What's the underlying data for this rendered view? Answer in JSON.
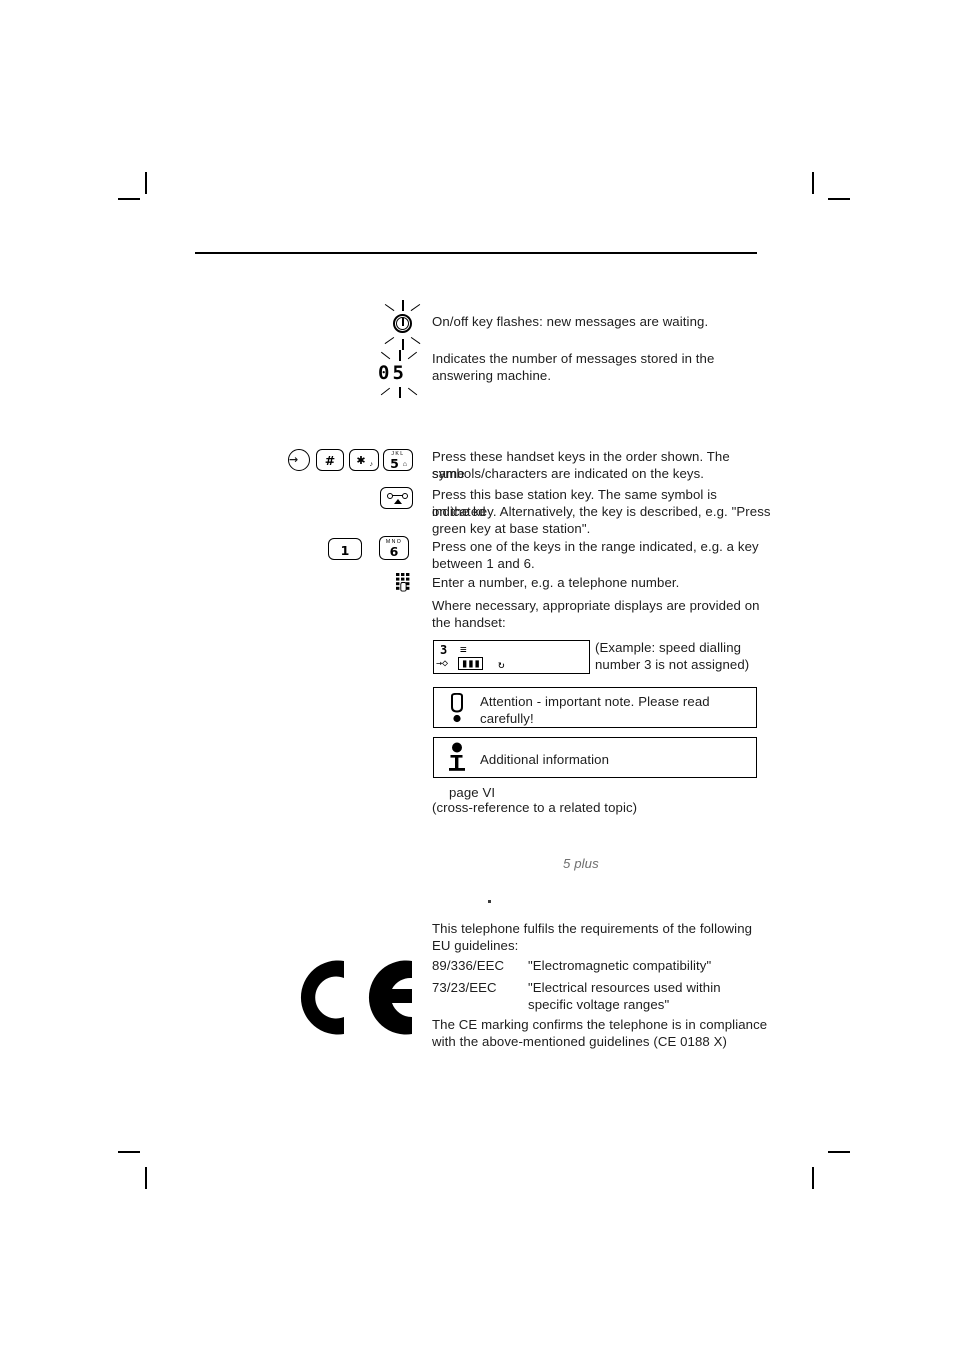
{
  "document": {
    "footer_note": "5 plus"
  },
  "legend": {
    "rows": [
      {
        "icon": "flashing-power-key-icon",
        "text": "On/off key flashes: new messages are waiting."
      },
      {
        "icon": "flashing-message-count-icon",
        "display_value": "05",
        "text_line1": "Indicates the number of messages stored in the",
        "text_line2": "answering machine."
      }
    ]
  },
  "keys_section": {
    "handset_keys": {
      "keys": [
        {
          "name": "arrow-in-circle-key",
          "main": "→",
          "sup": ""
        },
        {
          "name": "hash-key",
          "main": "#",
          "sup": ""
        },
        {
          "name": "star-key",
          "main": "✱",
          "sup": "",
          "sub": "♪"
        },
        {
          "name": "five-key",
          "main": "5",
          "sup": "JKL",
          "sub": "⌂"
        }
      ],
      "text_line1": "Press these handset keys in the order shown. The same",
      "text_line2": "symbols/characters are indicated on the keys."
    },
    "base_station_key": {
      "icon": "answering-machine-key-icon",
      "text_line1": "Press this base station key. The same symbol is indicated",
      "text_line2": "on the key. Alternatively, the key is described, e.g. \"Press",
      "text_line3": "green key at base station\"."
    },
    "range_keys": {
      "key_from": {
        "name": "one-key",
        "main": "1",
        "sup": ""
      },
      "key_to": {
        "name": "six-key",
        "main": "6",
        "sup": "MNO"
      },
      "text_line1": "Press one of the keys in the range indicated, e.g. a key",
      "text_line2": "between 1 and 6."
    },
    "keypad_entry": {
      "icon": "keypad-entry-icon",
      "text": "Enter a number, e.g. a telephone number."
    },
    "display_intro": {
      "text_line1": "Where necessary, appropriate displays are provided on",
      "text_line2": "the handset:"
    }
  },
  "display_example": {
    "lcd_line1": "3",
    "lcd_line1_symbol": "≡",
    "lcd_line2_arrow": "→◇",
    "lcd_line2_battery": "▮▮▮",
    "lcd_line2_symbol": "↻",
    "caption_line1": "(Example: speed dialling",
    "caption_line2": "number 3 is not assigned)"
  },
  "notes": {
    "attention": {
      "icon": "exclamation-mark-icon",
      "text_line1": "Attention - important note. Please read",
      "text_line2": "carefully!"
    },
    "info": {
      "icon": "information-i-icon",
      "text": "Additional information"
    }
  },
  "cross_reference": {
    "page_label": "page VI",
    "description": "(cross-reference to a related topic)"
  },
  "ce_section": {
    "logo": "ce-marking-logo",
    "intro_line1": "This telephone fulfils the requirements of the following",
    "intro_line2": "EU guidelines:",
    "guidelines": [
      {
        "code": "89/336/EEC",
        "title_line1": "\"Electromagnetic compatibility\"",
        "title_line2": ""
      },
      {
        "code": "73/23/EEC",
        "title_line1": "\"Electrical resources used within",
        "title_line2": "specific voltage ranges\""
      }
    ],
    "compliance_line1": "The CE marking confirms the telephone is in compliance",
    "compliance_line2": "with the above-mentioned guidelines (CE 0188 X)"
  }
}
